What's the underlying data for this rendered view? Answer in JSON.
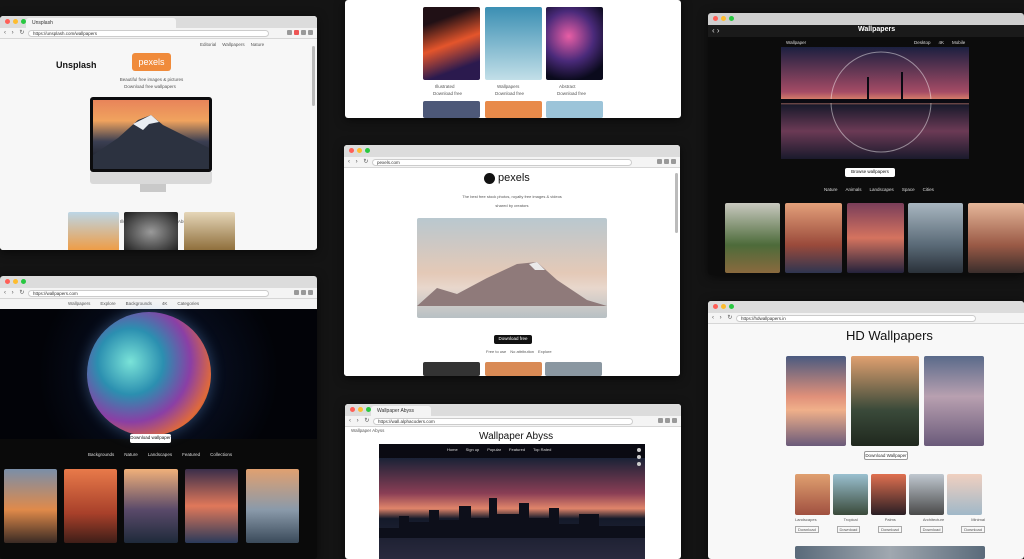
{
  "unsplash": {
    "tab": "Unsplash",
    "url": "https://unsplash.com/wallpapers",
    "brand": "Unsplash",
    "logo": "pexels",
    "tagline": "Beautiful free images & pictures",
    "tagline2": "Download free wallpapers",
    "nav": [
      "Editorial",
      "Wallpapers",
      "Nature"
    ]
  },
  "gallery_top": {
    "captions": [
      "Illustrated",
      "Wallpapers",
      "Abstract"
    ],
    "subcaptions": [
      "Download free",
      "Download free",
      "Download free"
    ]
  },
  "abyss": {
    "brand": "Wallpaper Abyss",
    "nav": [
      "Home",
      "Sign up",
      "Popular",
      "Featured",
      "Top Rated"
    ]
  },
  "cosmic": {
    "url": "https://wallpapers.com",
    "nav": [
      "Wallpapers",
      "Explore",
      "Backgrounds",
      "4K",
      "Categories"
    ],
    "button": "Download wallpaper",
    "tabs": [
      "Backgrounds",
      "Nature",
      "Landscapes",
      "Featured",
      "Collections"
    ]
  },
  "pexels": {
    "url": "pexels.com",
    "brand": "pexels",
    "tagline": "The best free stock photos, royalty free images & videos",
    "tagline2": "shared by creators",
    "button": "Download free",
    "links": [
      "Free to use",
      "No attribution",
      "Explore"
    ]
  },
  "wallpaper_abyss": {
    "tab": "Wallpaper Abyss",
    "url": "https://wall.alphacoders.com",
    "brand": "Wallpaper Abyss"
  },
  "hd_wallpapers": {
    "url": "https://hdwallpapers.in",
    "brand": "HD Wallpapers",
    "button": "Download Wallpaper",
    "thumb_labels": [
      "Landscapes",
      "Tropical",
      "Palms",
      "Architecture",
      "Minimal"
    ],
    "thumb_buttons": [
      "Download",
      "Download",
      "Download",
      "Download",
      "Download"
    ]
  },
  "wallpaper_dark": {
    "title": "Wallpapers",
    "brand_left": "Wallpaper",
    "nav": [
      "Desktop",
      "4K",
      "Mobile"
    ],
    "button": "Browse wallpapers",
    "cats": [
      "Nature",
      "Animals",
      "Landscapes",
      "Space",
      "Cities"
    ]
  }
}
